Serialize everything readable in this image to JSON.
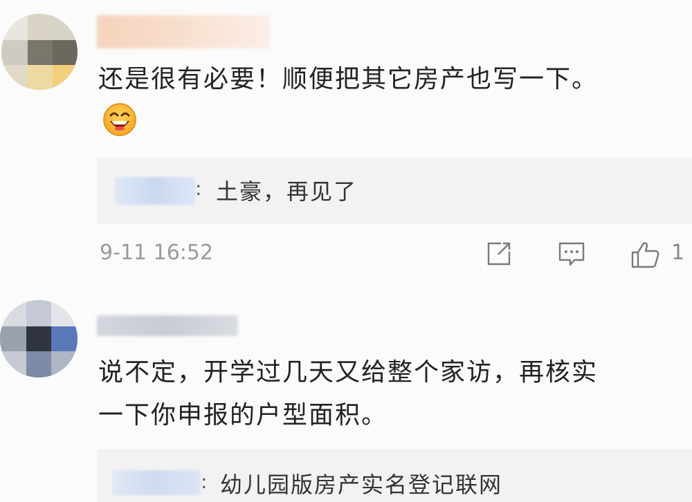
{
  "comments": [
    {
      "text": "还是很有必要！顺便把其它房产也写一下。",
      "emoji": "grinning-face-emoji",
      "reply": {
        "text": "土豪，再见了"
      },
      "timestamp": "9-11 16:52",
      "like_count": "1"
    },
    {
      "text_line1": "说不定，开学过几天又给整个家访，再核实",
      "text_line2": "一下你申报的户型面积。",
      "reply": {
        "text": "幼儿园版房产实名登记联网"
      }
    }
  ],
  "icons": {
    "share": "share-icon",
    "comment": "comment-icon",
    "like": "thumbs-up-icon"
  },
  "colors": {
    "background": "#fbfbfb",
    "reply_background": "#f2f2f2",
    "text": "#222222",
    "meta": "#9a9a9a"
  }
}
